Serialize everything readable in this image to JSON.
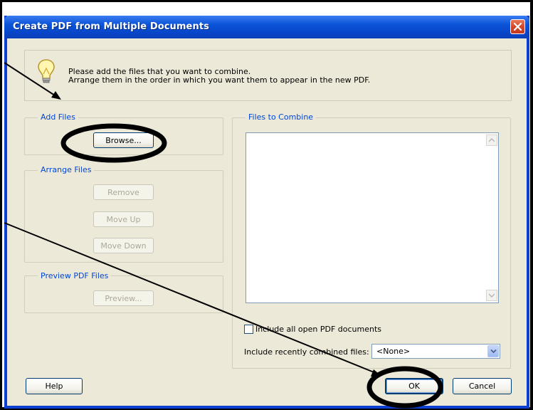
{
  "window": {
    "title": "Create PDF from Multiple Documents",
    "close_icon": "close-icon",
    "accent": "#0a53d8"
  },
  "info": {
    "icon": "lightbulb-icon",
    "line1": "Please add the files that you want to combine.",
    "line2": "Arrange them in the order in which you want them to appear in the new PDF."
  },
  "add_files": {
    "label": "Add Files",
    "browse_label": "Browse..."
  },
  "arrange_files": {
    "label": "Arrange Files",
    "remove_label": "Remove",
    "move_up_label": "Move Up",
    "move_down_label": "Move Down"
  },
  "preview": {
    "label": "Preview PDF Files",
    "preview_label": "Preview..."
  },
  "files_to_combine": {
    "label": "Files to Combine",
    "items": []
  },
  "options": {
    "include_open_label": "Include all open PDF documents",
    "include_open_checked": false,
    "recent_label": "Include recently combined files:",
    "recent_value": "<None>"
  },
  "footer": {
    "help_label": "Help",
    "ok_label": "OK",
    "cancel_label": "Cancel"
  }
}
